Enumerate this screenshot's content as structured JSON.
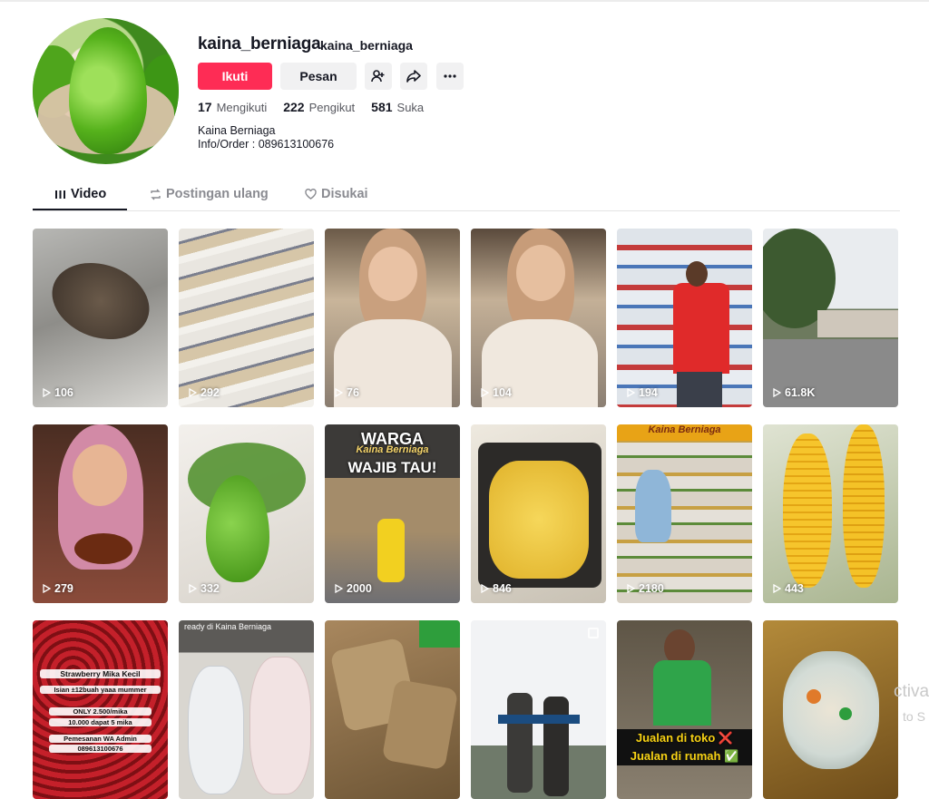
{
  "profile": {
    "username": "kaina_berniaga",
    "nickname": "kaina_berniaga",
    "follow_label": "Ikuti",
    "message_label": "Pesan",
    "following_count": "17",
    "following_label": "Mengikuti",
    "followers_count": "222",
    "followers_label": "Pengikut",
    "likes_count": "581",
    "likes_label": "Suka",
    "bio_line1": "Kaina Berniaga",
    "bio_line2": "Info/Order : 089613100676"
  },
  "tabs": [
    {
      "label": "Video",
      "active": true,
      "icon": "grid-icon"
    },
    {
      "label": "Postingan ulang",
      "active": false,
      "icon": "repost-icon"
    },
    {
      "label": "Disukai",
      "active": false,
      "icon": "heart-icon"
    }
  ],
  "videos": [
    {
      "views": "106"
    },
    {
      "views": "292"
    },
    {
      "views": "76"
    },
    {
      "views": "104"
    },
    {
      "views": "194"
    },
    {
      "views": "61.8K"
    },
    {
      "views": "279"
    },
    {
      "views": "332"
    },
    {
      "views": "2000"
    },
    {
      "views": "846"
    },
    {
      "views": "2180"
    },
    {
      "views": "443"
    },
    {
      "views": ""
    },
    {
      "views": ""
    },
    {
      "views": ""
    },
    {
      "views": ""
    },
    {
      "views": ""
    },
    {
      "views": ""
    }
  ],
  "thumb_text": {
    "t9_line1": "WARGA",
    "t9_line2": "Kaina Berniaga",
    "t9_line3": "WAJIB TAU!",
    "t11_top": "Kaina Berniaga",
    "t13_line1": "Strawberry Mika Kecil",
    "t13_line2": "Isian ±12buah yaaa mummer",
    "t13_line3": "ONLY 2.500/mika",
    "t13_line4": "10.000 dapat 5 mika",
    "t13_line5": "Pemesanan WA Admin",
    "t13_line6": "089613100676",
    "t14_top": "ready di Kaina Berniaga",
    "t17_line1": "Jualan di toko ❌",
    "t17_line2": "Jualan di rumah ✅"
  },
  "watermark": {
    "line1": "ctiva",
    "line2": "to S"
  },
  "colors": {
    "accent": "#fe2c55",
    "text": "#161823",
    "muted": "#57585f"
  }
}
